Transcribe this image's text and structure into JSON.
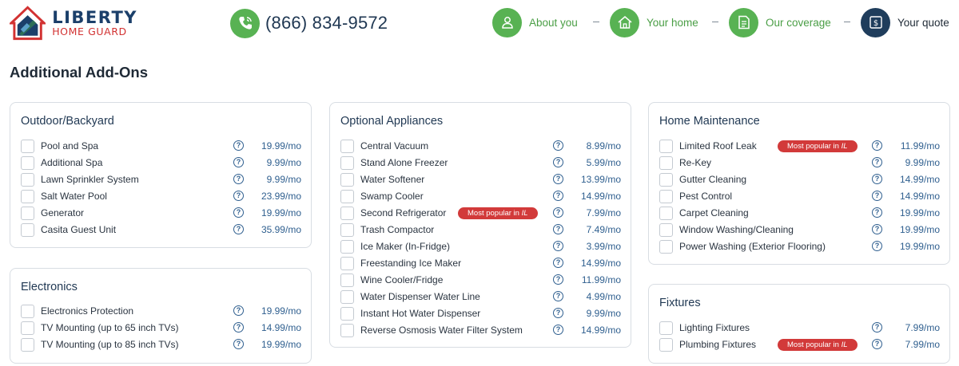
{
  "header": {
    "logo": {
      "line1": "LIBERTY",
      "line2": "HOME GUARD"
    },
    "phone": {
      "number": "(866) 834-9572",
      "icon": "phone-icon"
    },
    "steps": [
      {
        "label": "About you",
        "icon": "person-icon",
        "state": "done"
      },
      {
        "label": "Your home",
        "icon": "house-icon",
        "state": "done"
      },
      {
        "label": "Our coverage",
        "icon": "document-icon",
        "state": "done"
      },
      {
        "label": "Your quote",
        "icon": "dollar-icon",
        "state": "current"
      }
    ]
  },
  "page": {
    "title": "Additional Add-Ons"
  },
  "colors": {
    "accent_green": "#58b253",
    "navy": "#1f3d5c",
    "price_blue": "#2f5f8f",
    "badge_red": "#d23a3a",
    "logo_red": "#d23232"
  },
  "badge": {
    "text": "Most popular in ",
    "state": "IL"
  },
  "cards": {
    "outdoor": {
      "title": "Outdoor/Backyard",
      "items": [
        {
          "label": "Pool and Spa",
          "price": "19.99/mo"
        },
        {
          "label": "Additional Spa",
          "price": "9.99/mo"
        },
        {
          "label": "Lawn Sprinkler System",
          "price": "9.99/mo"
        },
        {
          "label": "Salt Water Pool",
          "price": "23.99/mo"
        },
        {
          "label": "Generator",
          "price": "19.99/mo"
        },
        {
          "label": "Casita Guest Unit",
          "price": "35.99/mo"
        }
      ]
    },
    "electronics": {
      "title": "Electronics",
      "items": [
        {
          "label": "Electronics Protection",
          "price": "19.99/mo"
        },
        {
          "label": "TV Mounting (up to 65 inch TVs)",
          "price": "14.99/mo"
        },
        {
          "label": "TV Mounting (up to 85 inch TVs)",
          "price": "19.99/mo"
        }
      ]
    },
    "appliances": {
      "title": "Optional Appliances",
      "items": [
        {
          "label": "Central Vacuum",
          "price": "8.99/mo"
        },
        {
          "label": "Stand Alone Freezer",
          "price": "5.99/mo"
        },
        {
          "label": "Water Softener",
          "price": "13.99/mo"
        },
        {
          "label": "Swamp Cooler",
          "price": "14.99/mo"
        },
        {
          "label": "Second Refrigerator",
          "price": "7.99/mo",
          "popular": true
        },
        {
          "label": "Trash Compactor",
          "price": "7.49/mo"
        },
        {
          "label": "Ice Maker (In-Fridge)",
          "price": "3.99/mo"
        },
        {
          "label": "Freestanding Ice Maker",
          "price": "14.99/mo"
        },
        {
          "label": "Wine Cooler/Fridge",
          "price": "11.99/mo"
        },
        {
          "label": "Water Dispenser Water Line",
          "price": "4.99/mo"
        },
        {
          "label": "Instant Hot Water Dispenser",
          "price": "9.99/mo"
        },
        {
          "label": "Reverse Osmosis Water Filter System",
          "price": "14.99/mo"
        }
      ]
    },
    "maintenance": {
      "title": "Home Maintenance",
      "items": [
        {
          "label": "Limited Roof Leak",
          "price": "11.99/mo",
          "popular": true
        },
        {
          "label": "Re-Key",
          "price": "9.99/mo"
        },
        {
          "label": "Gutter Cleaning",
          "price": "14.99/mo"
        },
        {
          "label": "Pest Control",
          "price": "14.99/mo"
        },
        {
          "label": "Carpet Cleaning",
          "price": "19.99/mo"
        },
        {
          "label": "Window Washing/Cleaning",
          "price": "19.99/mo"
        },
        {
          "label": "Power Washing (Exterior Flooring)",
          "price": "19.99/mo"
        }
      ]
    },
    "fixtures": {
      "title": "Fixtures",
      "items": [
        {
          "label": "Lighting Fixtures",
          "price": "7.99/mo"
        },
        {
          "label": "Plumbing Fixtures",
          "price": "7.99/mo",
          "popular": true
        }
      ]
    }
  }
}
